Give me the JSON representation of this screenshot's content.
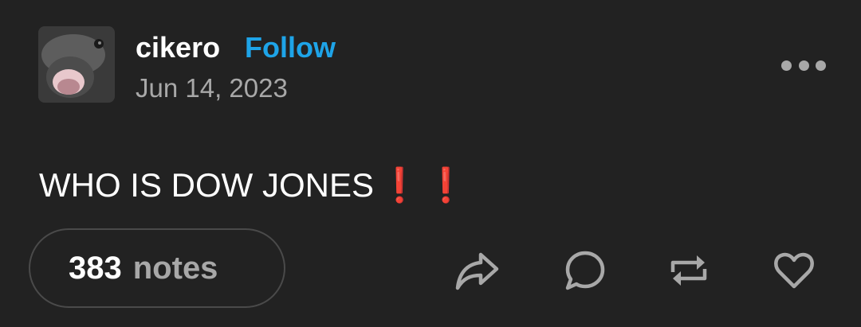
{
  "post": {
    "username": "cikero",
    "follow_label": "Follow",
    "date": "Jun 14, 2023",
    "body_text": "WHO IS DOW JONES",
    "emphasis_1": "❗",
    "emphasis_2": "❗",
    "notes_count": "383",
    "notes_label": "notes"
  },
  "icons": {
    "avatar": "avatar-fish-photo",
    "more": "more-horizontal-icon",
    "share": "share-arrow-icon",
    "reply": "comment-bubble-icon",
    "reblog": "reblog-icon",
    "like": "heart-icon"
  },
  "colors": {
    "background": "#222222",
    "accent": "#1ea4e8",
    "muted": "#a8a8a8",
    "exclamation": "#e3262e"
  }
}
